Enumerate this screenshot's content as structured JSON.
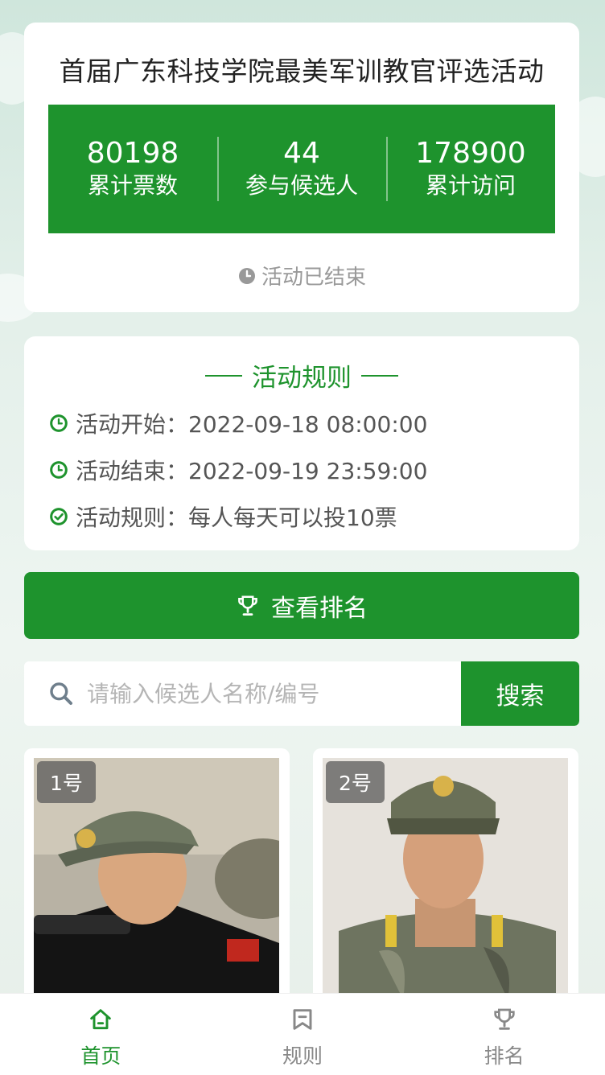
{
  "header": {
    "title": "首届广东科技学院最美军训教官评选活动",
    "stats": [
      {
        "value": "80198",
        "label": "累计票数"
      },
      {
        "value": "44",
        "label": "参与候选人"
      },
      {
        "value": "178900",
        "label": "累计访问"
      }
    ],
    "status": "活动已结束"
  },
  "rules": {
    "heading": "活动规则",
    "items": [
      {
        "icon": "clock-icon",
        "text": "活动开始：2022-09-18 08:00:00"
      },
      {
        "icon": "clock-icon",
        "text": "活动结束：2022-09-19 23:59:00"
      },
      {
        "icon": "check-circle-icon",
        "text": "活动规则：每人每天可以投10票"
      }
    ]
  },
  "ranking_button": {
    "label": "查看排名",
    "icon": "trophy-icon"
  },
  "search": {
    "placeholder": "请输入候选人名称/编号",
    "value": "",
    "button_label": "搜索"
  },
  "candidates": [
    {
      "number": "1号"
    },
    {
      "number": "2号"
    }
  ],
  "tab_bar": {
    "items": [
      {
        "label": "首页",
        "icon": "home-icon",
        "active": true
      },
      {
        "label": "规则",
        "icon": "bookmark-icon",
        "active": false
      },
      {
        "label": "排名",
        "icon": "trophy-icon",
        "active": false
      }
    ]
  },
  "colors": {
    "accent": "#1e932d",
    "muted": "#999999"
  }
}
